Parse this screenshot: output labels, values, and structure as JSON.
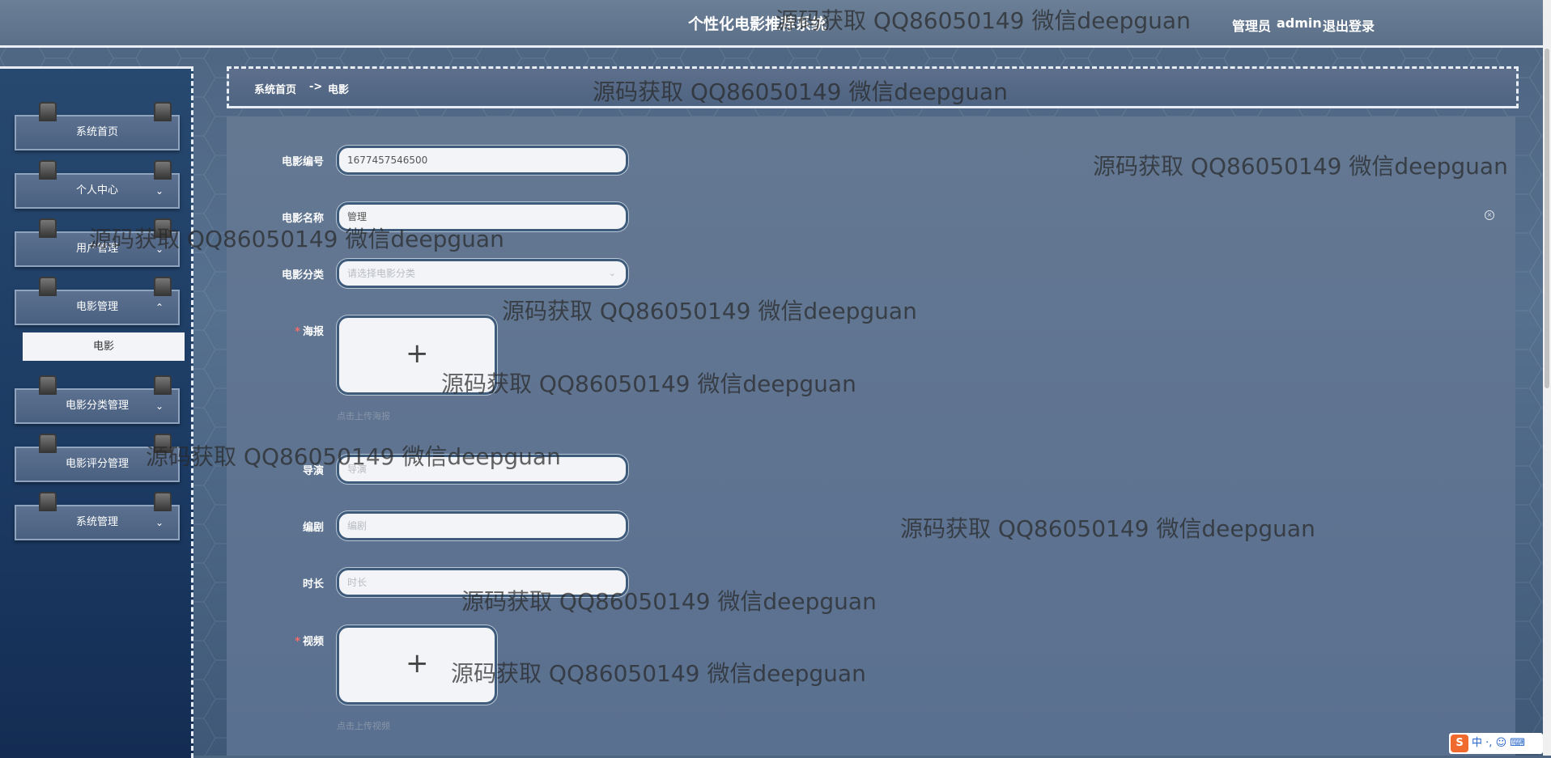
{
  "header": {
    "title": "个性化电影推荐系统",
    "user_role": "管理员",
    "user_name": "admin",
    "logout_label": "退出登录"
  },
  "sidebar": {
    "items": [
      {
        "label": "系统首页"
      },
      {
        "label": "个人中心"
      },
      {
        "label": "用户管理"
      },
      {
        "label": "电影管理"
      },
      {
        "label": "电影分类管理"
      },
      {
        "label": "电影评分管理"
      },
      {
        "label": "系统管理"
      }
    ],
    "active_sub_item": "电影"
  },
  "breadcrumb": {
    "home": "系统首页",
    "separator": "->",
    "current": "电影"
  },
  "form": {
    "movie_no": {
      "label": "电影编号",
      "value": "1677457546500"
    },
    "movie_name": {
      "label": "电影名称",
      "value": "管理"
    },
    "category": {
      "label": "电影分类",
      "placeholder": "请选择电影分类"
    },
    "poster": {
      "label": "海报",
      "hint": "点击上传海报"
    },
    "director": {
      "label": "导演",
      "placeholder": "导演"
    },
    "writer": {
      "label": "编剧",
      "placeholder": "编剧"
    },
    "duration": {
      "label": "时长",
      "placeholder": "时长"
    },
    "video": {
      "label": "视频",
      "hint": "点击上传视频"
    }
  },
  "watermark": "源码获取 QQ86050149 微信deepguan",
  "ime": {
    "label": "中"
  },
  "colors": {
    "required": "#f56c6c",
    "sidebar_bg": "#1b3a63",
    "ime_brand": "#ef6a2c"
  }
}
